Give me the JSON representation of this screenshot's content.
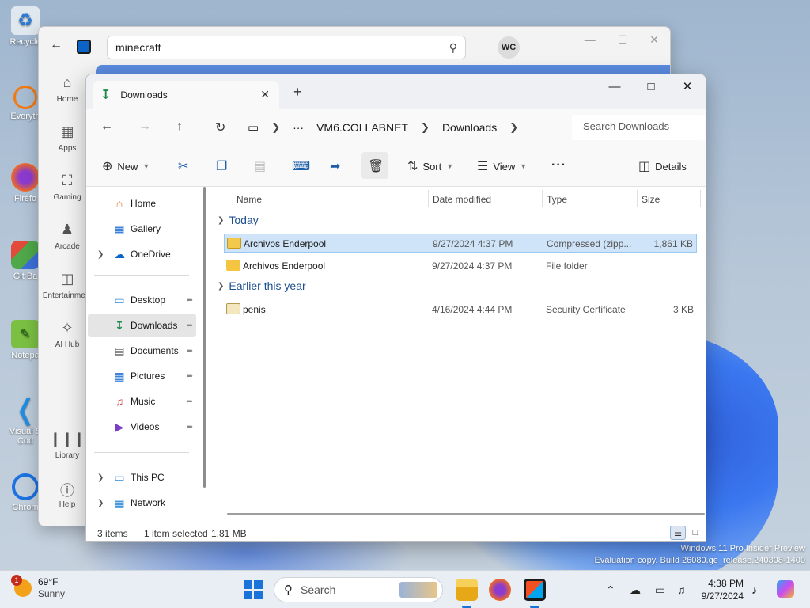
{
  "desktop": {
    "icons": [
      "Recycle",
      "Everyth",
      "Firefo",
      "Git Ba",
      "Notepa",
      "Visual S Cod",
      "Chrom"
    ],
    "watermark_line1": "Windows 11 Pro Insider Preview",
    "watermark_line2": "Evaluation copy. Build 26080.ge_release.240308-1400"
  },
  "store": {
    "search_value": "minecraft",
    "avatar_initials": "WC",
    "nav": [
      "Home",
      "Apps",
      "Gaming",
      "Arcade",
      "Entertainment",
      "AI Hub",
      "Library",
      "Help"
    ]
  },
  "explorer": {
    "tab_title": "Downloads",
    "address": {
      "ellipsis": "···",
      "segments": [
        "VM6.COLLABNET",
        "Downloads"
      ]
    },
    "search_placeholder": "Search Downloads",
    "toolbar": {
      "new": "New",
      "sort": "Sort",
      "view": "View",
      "details": "Details"
    },
    "nav_pane": {
      "home": "Home",
      "gallery": "Gallery",
      "onedrive": "OneDrive",
      "desktop": "Desktop",
      "downloads": "Downloads",
      "documents": "Documents",
      "pictures": "Pictures",
      "music": "Music",
      "videos": "Videos",
      "this_pc": "This PC",
      "network": "Network"
    },
    "columns": [
      "Name",
      "Date modified",
      "Type",
      "Size"
    ],
    "groups": {
      "today": "Today",
      "earlier": "Earlier this year"
    },
    "files": [
      {
        "name": "Archivos Enderpool",
        "date": "9/27/2024 4:37 PM",
        "type": "Compressed (zipp...",
        "size": "1,861 KB",
        "selected": true
      },
      {
        "name": "Archivos Enderpool",
        "date": "9/27/2024 4:37 PM",
        "type": "File folder",
        "size": "",
        "selected": false
      },
      {
        "name": "penis",
        "date": "4/16/2024 4:44 PM",
        "type": "Security Certificate",
        "size": "3 KB",
        "selected": false
      }
    ],
    "status": {
      "items": "3 items",
      "selected": "1 item selected",
      "size": "1.81 MB"
    }
  },
  "taskbar": {
    "weather_temp": "69°F",
    "weather_desc": "Sunny",
    "weather_badge": "1",
    "search_placeholder": "Search",
    "time": "4:38 PM",
    "date": "9/27/2024"
  },
  "colors": {
    "accent": "#1a73d9",
    "selection": "#cfe4f8",
    "group_header": "#1d4f91"
  }
}
